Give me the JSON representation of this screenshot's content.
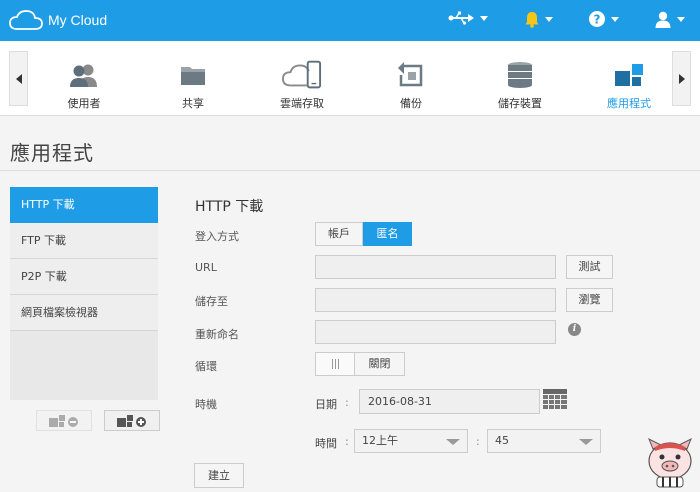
{
  "app": {
    "title": "My Cloud"
  },
  "topbar": {
    "icons": [
      "usb-icon",
      "bell-icon",
      "help-icon",
      "user-icon"
    ],
    "accent": "#1f9ce6",
    "bell_color": "#f5c518"
  },
  "nav": {
    "items": [
      {
        "label": "使用者",
        "icon": "users-icon"
      },
      {
        "label": "共享",
        "icon": "folder-icon"
      },
      {
        "label": "雲端存取",
        "icon": "cloud-device-icon"
      },
      {
        "label": "備份",
        "icon": "backup-icon"
      },
      {
        "label": "儲存裝置",
        "icon": "storage-icon"
      },
      {
        "label": "應用程式",
        "icon": "apps-icon",
        "active": true
      }
    ]
  },
  "page": {
    "title": "應用程式"
  },
  "sidebar": {
    "items": [
      {
        "label": "HTTP 下載",
        "active": true
      },
      {
        "label": "FTP 下載"
      },
      {
        "label": "P2P 下載"
      },
      {
        "label": "網頁檔案檢視器"
      }
    ],
    "remove_icon": "remove-app-icon",
    "add_icon": "add-app-icon"
  },
  "form": {
    "title": "HTTP 下載",
    "login_method": {
      "label": "登入方式",
      "options": [
        "帳戶",
        "匿名"
      ],
      "selected": "匿名"
    },
    "url": {
      "label": "URL",
      "value": "",
      "button": "測試"
    },
    "save_to": {
      "label": "儲存至",
      "value": "",
      "button": "瀏覽"
    },
    "rename": {
      "label": "重新命名",
      "value": ""
    },
    "repeat": {
      "label": "循環",
      "state": "關閉"
    },
    "timing": {
      "label": "時機",
      "date_label": "日期",
      "date_value": "2016-08-31",
      "time_label": "時間",
      "hour_value": "12上午",
      "minute_value": "45"
    },
    "create_button": "建立"
  }
}
